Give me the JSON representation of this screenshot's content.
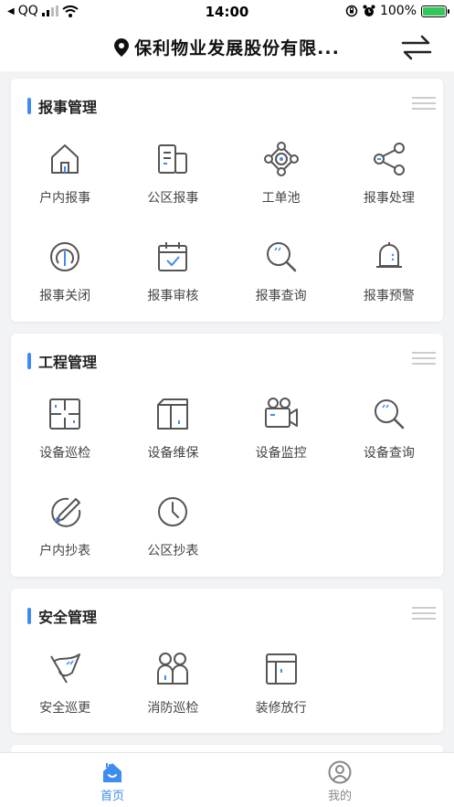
{
  "status_bar": {
    "back_app": "QQ",
    "time": "14:00",
    "battery": "100%"
  },
  "header": {
    "title": "保利物业发展股份有限..."
  },
  "sections": [
    {
      "title": "报事管理",
      "items": [
        {
          "label": "户内报事",
          "icon": "house-icon"
        },
        {
          "label": "公区报事",
          "icon": "buildings-icon"
        },
        {
          "label": "工单池",
          "icon": "network-icon"
        },
        {
          "label": "报事处理",
          "icon": "share-icon"
        },
        {
          "label": "报事关闭",
          "icon": "power-icon"
        },
        {
          "label": "报事审核",
          "icon": "calendar-check-icon"
        },
        {
          "label": "报事查询",
          "icon": "search-icon"
        },
        {
          "label": "报事预警",
          "icon": "bell-icon"
        }
      ]
    },
    {
      "title": "工程管理",
      "items": [
        {
          "label": "设备巡检",
          "icon": "scan-icon"
        },
        {
          "label": "设备维保",
          "icon": "cabinet-icon"
        },
        {
          "label": "设备监控",
          "icon": "video-camera-icon"
        },
        {
          "label": "设备查询",
          "icon": "search-icon"
        },
        {
          "label": "户内抄表",
          "icon": "pencil-icon"
        },
        {
          "label": "公区抄表",
          "icon": "clock-icon"
        }
      ]
    },
    {
      "title": "安全管理",
      "items": [
        {
          "label": "安全巡更",
          "icon": "flag-icon"
        },
        {
          "label": "消防巡检",
          "icon": "people-icon"
        },
        {
          "label": "装修放行",
          "icon": "panel-icon"
        }
      ]
    }
  ],
  "tab_bar": {
    "home": "首页",
    "mine": "我的"
  },
  "colors": {
    "accent": "#3f8cf0",
    "icon_stroke": "#555555",
    "background": "#f2f3f5"
  }
}
